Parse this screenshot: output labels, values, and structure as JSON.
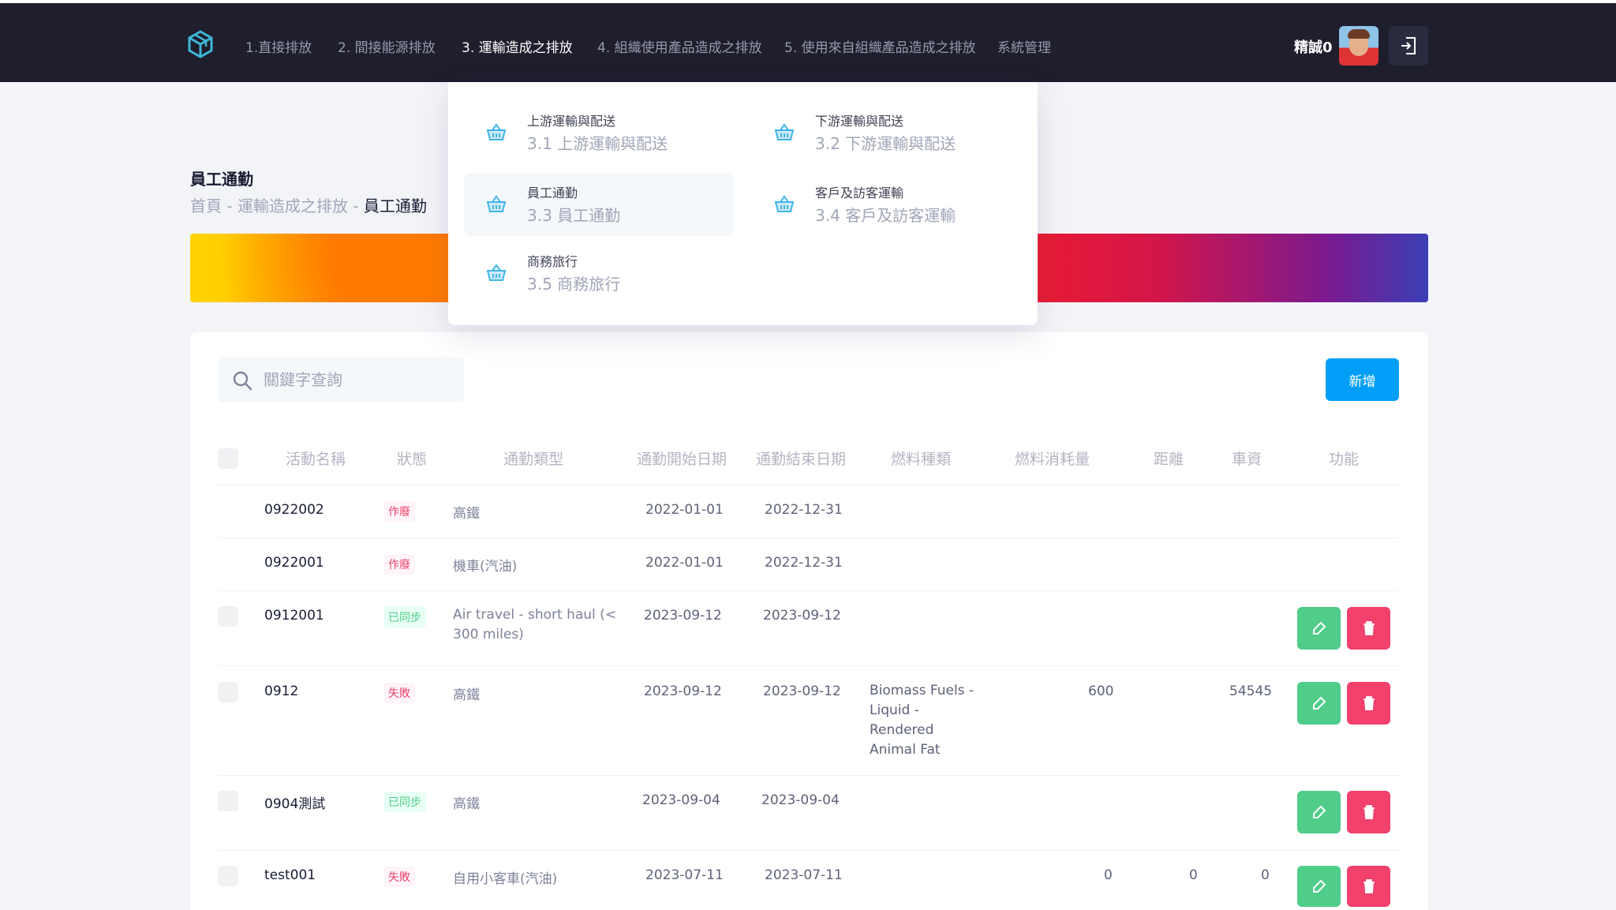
{
  "nav": {
    "items": [
      {
        "label": "1.直接排放"
      },
      {
        "label": "2. 間接能源排放"
      },
      {
        "label": "3. 運輸造成之排放"
      },
      {
        "label": "4. 組織使用產品造成之排放"
      },
      {
        "label": "5. 使用來自組織產品造成之排放"
      },
      {
        "label": "系統管理"
      }
    ],
    "active_index": 2,
    "user_name": "精誠0",
    "icons": {
      "logo": "cube-logo-icon",
      "logout": "logout-icon"
    }
  },
  "dropdown": {
    "items": [
      {
        "title": "上游運輸與配送",
        "sub": "3.1 上游運輸與配送"
      },
      {
        "title": "下游運輸與配送",
        "sub": "3.2 下游運輸與配送"
      },
      {
        "title": "員工通勤",
        "sub": "3.3 員工通勤"
      },
      {
        "title": "客戶及訪客運輸",
        "sub": "3.4 客戶及訪客運輸"
      },
      {
        "title": "商務旅行",
        "sub": "3.5 商務旅行"
      }
    ],
    "icon": "basket-icon",
    "highlighted_index": 2
  },
  "page": {
    "title": "員工通勤",
    "breadcrumb": {
      "home": "首頁",
      "sep": " - ",
      "section": "運輸造成之排放",
      "current": "員工通勤"
    }
  },
  "toolbar": {
    "search_placeholder": "關鍵字查詢",
    "add_label": "新增"
  },
  "table": {
    "headers": [
      "活動名稱",
      "狀態",
      "通勤類型",
      "通勤開始日期",
      "通勤結束日期",
      "燃料種類",
      "燃料消耗量",
      "距離",
      "車資",
      "功能"
    ],
    "rows": [
      {
        "name": "0922002",
        "status": "作廢",
        "type": "高鐵",
        "start": "2022-01-01",
        "end": "2022-12-31",
        "fuel": "",
        "consumption": "",
        "distance": "",
        "fare": ""
      },
      {
        "name": "0922001",
        "status": "作廢",
        "type": "機車(汽油)",
        "start": "2022-01-01",
        "end": "2022-12-31",
        "fuel": "",
        "consumption": "",
        "distance": "",
        "fare": ""
      },
      {
        "name": "0912001",
        "status": "已同步",
        "type": "Air travel - short haul (< 300 miles)",
        "start": "2023-09-12",
        "end": "2023-09-12",
        "fuel": "",
        "consumption": "",
        "distance": "",
        "fare": ""
      },
      {
        "name": "0912",
        "status": "失敗",
        "type": "高鐵",
        "start": "2023-09-12",
        "end": "2023-09-12",
        "fuel": "Biomass Fuels - Liquid - Rendered Animal Fat",
        "consumption": "600",
        "distance": "",
        "fare": "54545"
      },
      {
        "name": "0904測試",
        "status": "已同步",
        "type": "高鐵",
        "start": "2023-09-04",
        "end": "2023-09-04",
        "fuel": "",
        "consumption": "",
        "distance": "",
        "fare": ""
      },
      {
        "name": "test001",
        "status": "失敗",
        "type": "自用小客車(汽油)",
        "start": "2023-07-11",
        "end": "2023-07-11",
        "fuel": "",
        "consumption": "0",
        "distance": "0",
        "fare": "0"
      }
    ],
    "status_colors": {
      "作廢": "#f1416c",
      "失敗": "#f1416c",
      "已同步": "#50cd89"
    }
  },
  "colors": {
    "primary": "#009ef7",
    "success": "#50cd89",
    "danger": "#f1416c",
    "header_bg": "#1e1e2d"
  }
}
